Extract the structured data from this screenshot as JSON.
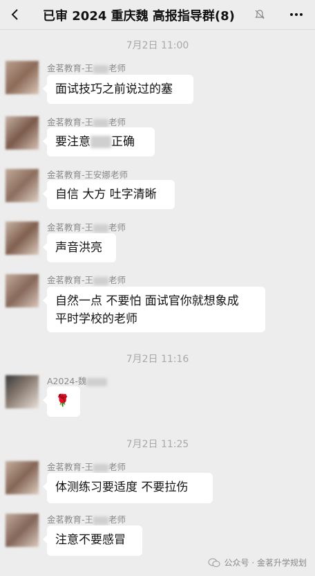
{
  "header": {
    "title": "已审 2024 重庆魏  高报指导群(8)"
  },
  "timestamps": [
    "7月2日 11:00",
    "7月2日 11:16",
    "7月2日 11:25"
  ],
  "messages": [
    {
      "sender": "金茗教育-王",
      "sender_suffix": "老师",
      "text": "面试技巧之前说过的塞"
    },
    {
      "sender": "金茗教育-王",
      "sender_suffix": "老师",
      "text_a": "要注意",
      "text_b": "正确"
    },
    {
      "sender": "金茗教育-王安娜老师",
      "text": "自信 大方 吐字清晰"
    },
    {
      "sender": "金茗教育-王",
      "sender_suffix": "老师",
      "text": "声音洪亮"
    },
    {
      "sender": "金茗教育-王",
      "sender_suffix": "老师",
      "line1": "自然一点 不要怕 面试官你就想象成",
      "line2": "平时学校的老师"
    },
    {
      "sender": "A2024-魏",
      "text": "🌹"
    },
    {
      "sender": "金茗教育-王",
      "sender_suffix": "老师",
      "text": "体测练习要适度 不要拉伤"
    },
    {
      "sender": "金茗教育-王",
      "sender_suffix": "老师",
      "text": "注意不要感冒"
    }
  ],
  "watermark": {
    "text": "公众号 · 金茗升学规划"
  },
  "colors": {
    "background": "#ededed",
    "bubble": "#ffffff",
    "muted_text": "#8a8a8a"
  }
}
